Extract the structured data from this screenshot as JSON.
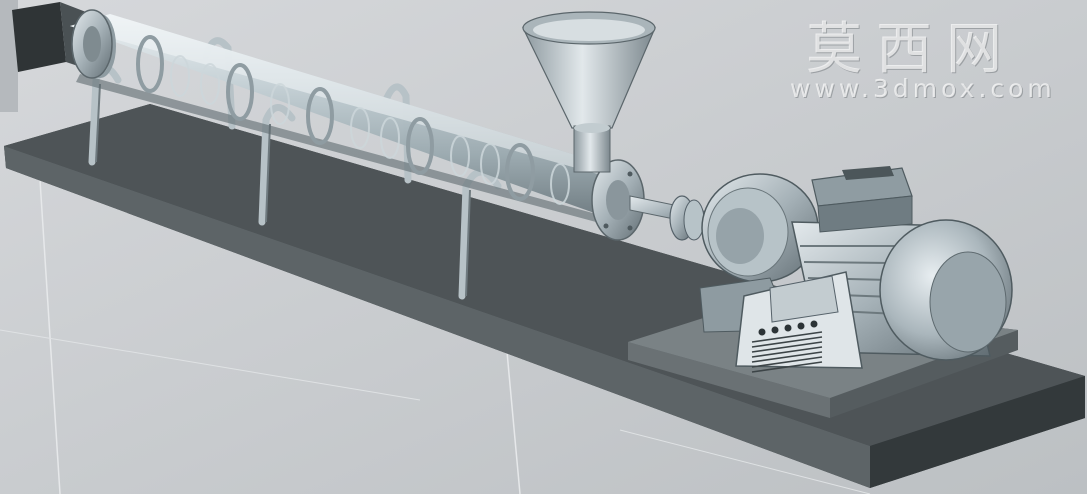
{
  "watermark": {
    "chinese": "莫西网",
    "url": "www.3dmox.com"
  },
  "scene": {
    "subject": "screw-conveyor-extruder",
    "hopper_icon": "hopper-icon",
    "control_panel": {
      "button_count": 5,
      "vent_lines": 7
    },
    "colors": {
      "background": "#c9cccf",
      "base": "#4e5457",
      "metal": "#a9b6bc",
      "glass": "#d8e2e6",
      "panel": "#dfe5e8"
    }
  }
}
